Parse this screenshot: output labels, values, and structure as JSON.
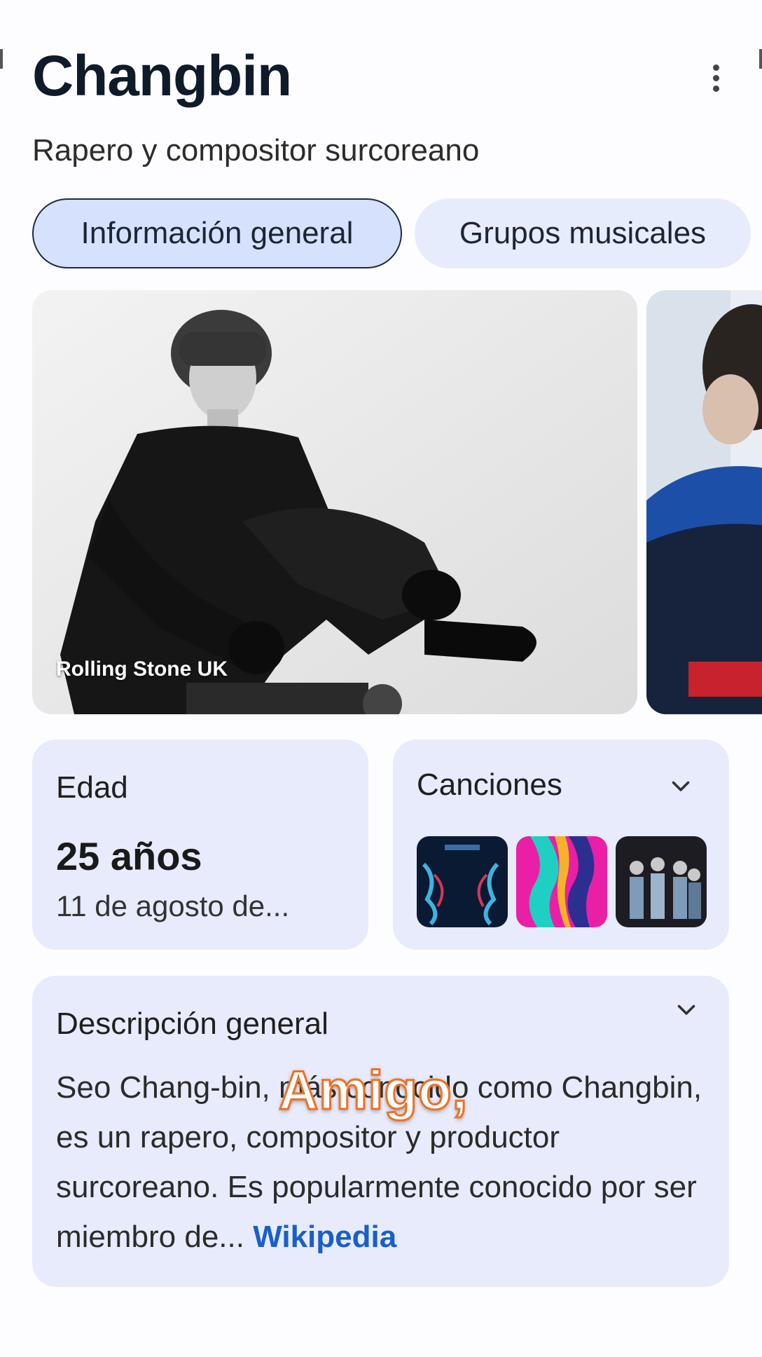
{
  "header": {
    "title": "Changbin",
    "subtitle": "Rapero y compositor surcoreano",
    "menu_icon": "more-vert-icon"
  },
  "tabs": [
    {
      "label": "Información general",
      "selected": true
    },
    {
      "label": "Grupos musicales",
      "selected": false
    }
  ],
  "images": {
    "main_caption": "Rolling Stone UK"
  },
  "age_card": {
    "label": "Edad",
    "value": "25 años",
    "date": "11 de agosto de..."
  },
  "songs_card": {
    "label": "Canciones",
    "icon": "chevron-down-icon"
  },
  "overview_card": {
    "label": "Descripción general",
    "icon": "chevron-down-icon",
    "text": "Seo Chang-bin, más conocido como Changbin, es un rapero, compositor y productor surcoreano. Es popularmente conocido por ser miembro de...",
    "source_link": "Wikipedia"
  },
  "overlay_caption": "Amigo,",
  "colors": {
    "accent": "#1a5fc8",
    "card_bg": "#e7ebfc",
    "selected_chip": "#d6e2fd",
    "overlay_stroke": "#e8742a"
  }
}
